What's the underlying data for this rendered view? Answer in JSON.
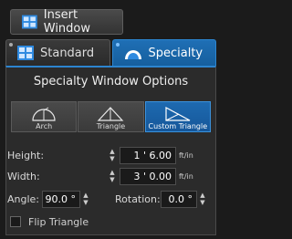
{
  "insert_button": {
    "label": "Insert Window",
    "icon": "window-icon"
  },
  "tabs": [
    {
      "label": "Standard",
      "icon": "window-icon",
      "active": false
    },
    {
      "label": "Specialty",
      "icon": "arch-window-icon",
      "active": true
    }
  ],
  "panel": {
    "title": "Specialty Window Options",
    "shapes": [
      {
        "label": "Arch",
        "icon": "arch-shape-icon",
        "selected": false
      },
      {
        "label": "Triangle",
        "icon": "triangle-shape-icon",
        "selected": false
      },
      {
        "label": "Custom Triangle",
        "icon": "custom-triangle-shape-icon",
        "selected": true
      }
    ],
    "height": {
      "label": "Height:",
      "value": "1 ' 6.00",
      "unit": "ft/in"
    },
    "width": {
      "label": "Width:",
      "value": "3 ' 0.00",
      "unit": "ft/in"
    },
    "angle": {
      "label": "Angle:",
      "value": "90.0 °"
    },
    "rotation": {
      "label": "Rotation:",
      "value": "0.0 °"
    },
    "flip": {
      "label": "Flip Triangle",
      "checked": false
    }
  },
  "colors": {
    "accent": "#1f6fb5",
    "background": "#1b1b1b",
    "panel": "#2b2b2b"
  }
}
